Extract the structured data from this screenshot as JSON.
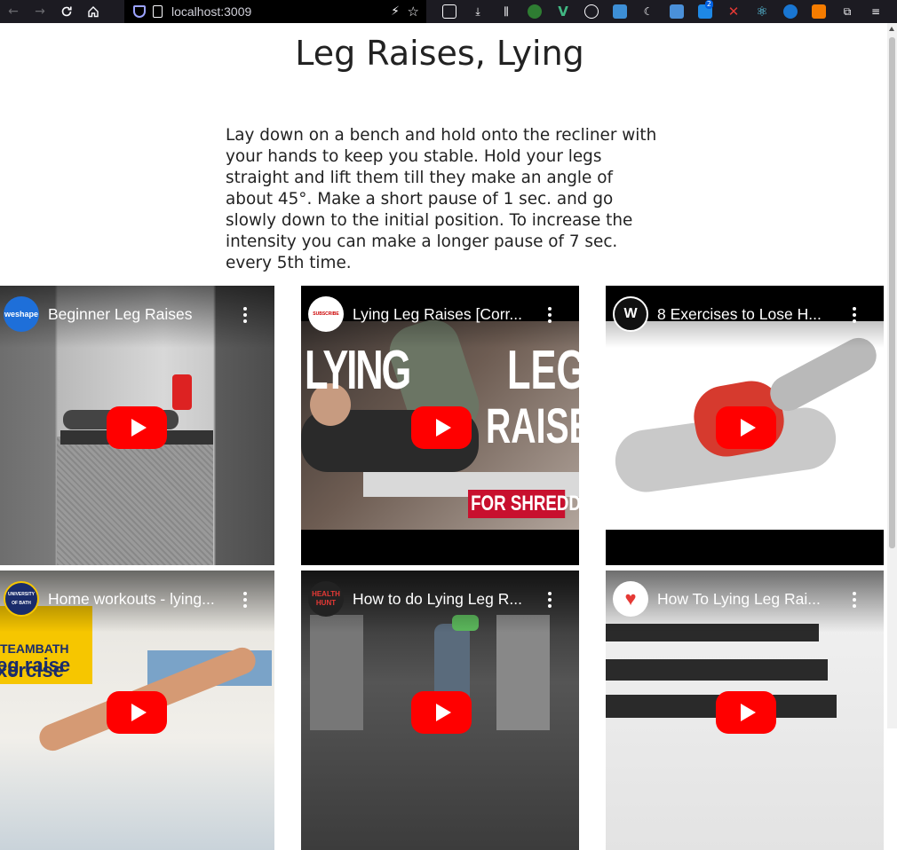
{
  "browser": {
    "url": "localhost:3009",
    "notification_count": "2"
  },
  "page": {
    "title": "Leg Raises, Lying",
    "description": "Lay down on a bench and hold onto the recliner with your hands to keep you stable. Hold your legs straight and lift them till they make an angle of about 45°. Make a short pause of 1 sec. and go slowly down to the initial position. To increase the intensity you can make a longer pause of 7 sec. every 5th time."
  },
  "videos": [
    {
      "title": "Beginner Leg Raises",
      "channel": "weshape"
    },
    {
      "title": "Lying Leg Raises [Corr...",
      "channel": "SUBSCRIBE",
      "overlay": [
        "LYING",
        "LEG",
        "RAISE",
        "FOR SHREDDED"
      ]
    },
    {
      "title": "8 Exercises to Lose H...",
      "channel": "W"
    },
    {
      "title": "Home workouts - lying...",
      "channel": "UNIVERSITY OF BATH",
      "overlay": [
        "TEAMBATH",
        "eg raise",
        "xercise"
      ]
    },
    {
      "title": "How to do Lying Leg R...",
      "channel": "HEALTH HUNT"
    },
    {
      "title": "How To Lying Leg Rai...",
      "channel": "♥"
    }
  ]
}
